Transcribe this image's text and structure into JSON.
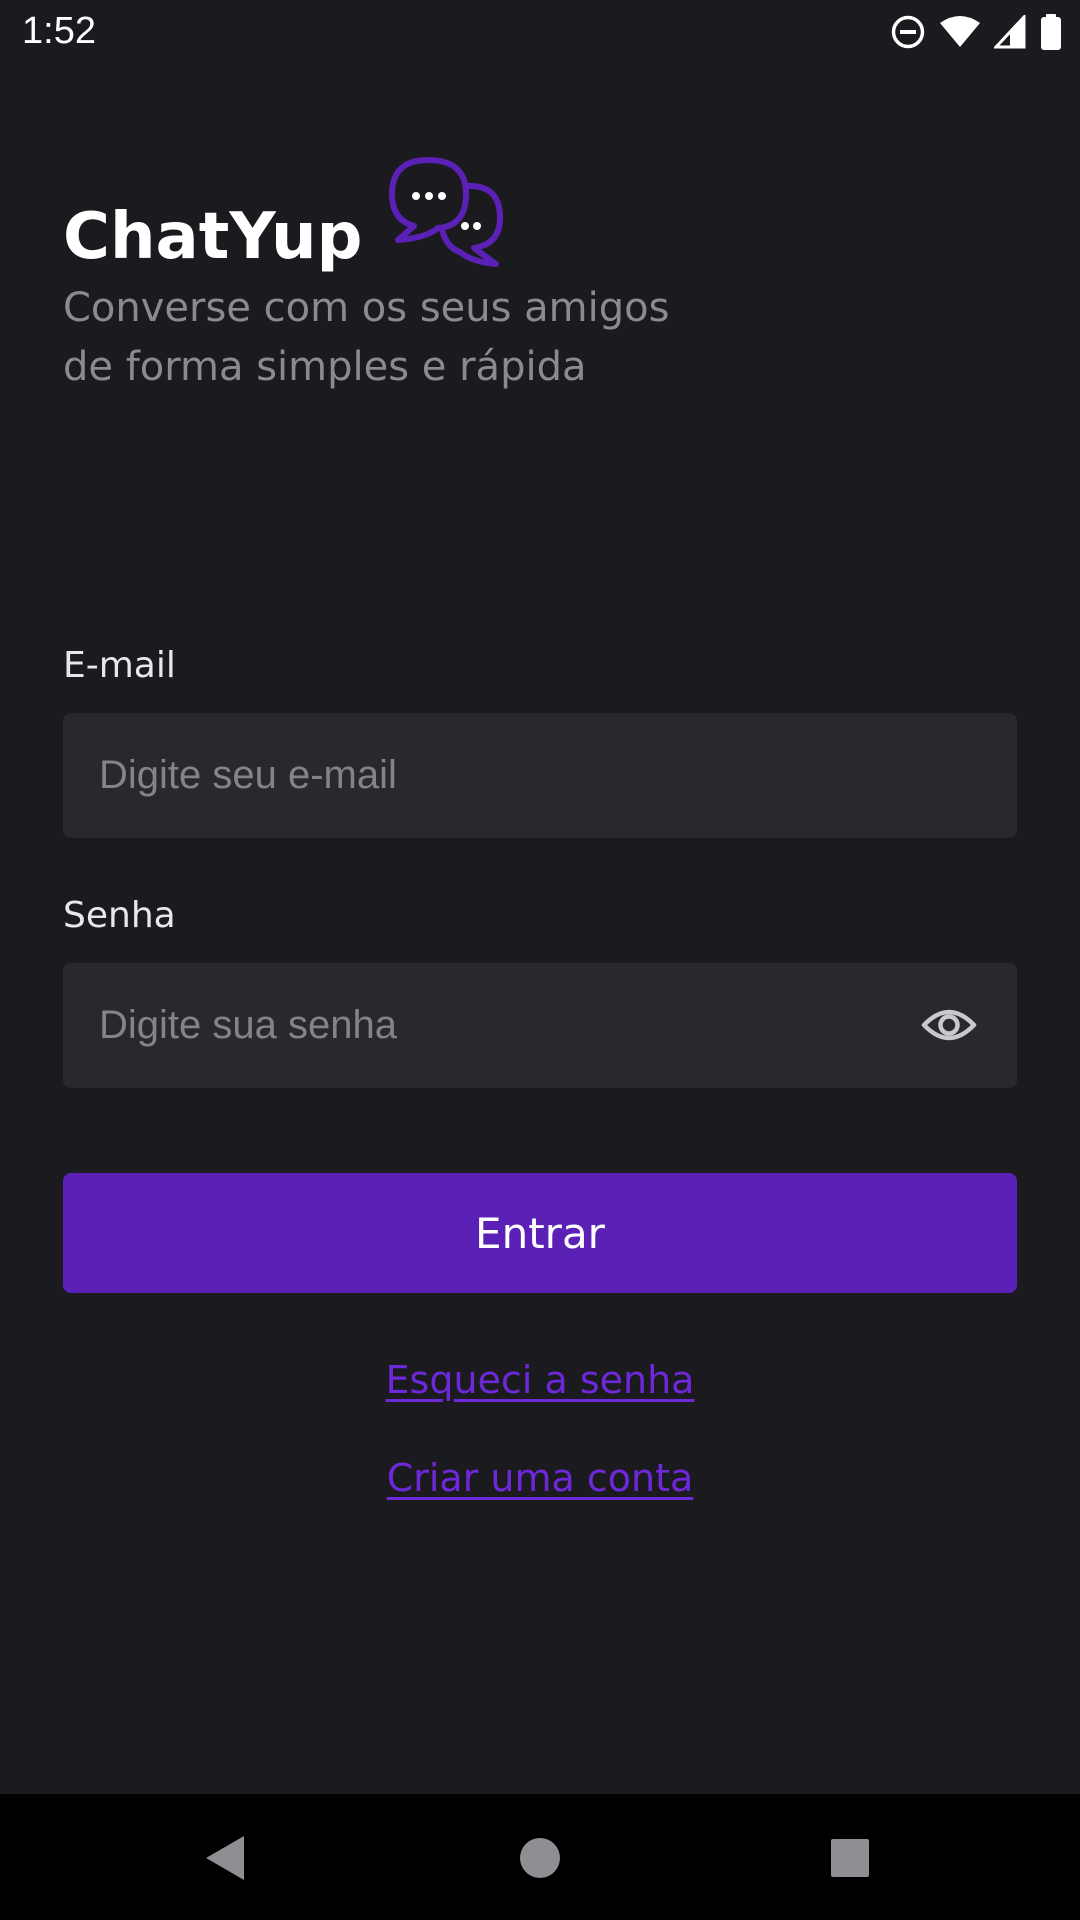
{
  "status_bar": {
    "time": "1:52",
    "icons": [
      "do-not-disturb-icon",
      "wifi-icon",
      "signal-icon",
      "battery-icon"
    ]
  },
  "header": {
    "app_name": "ChatYup",
    "logo_icon": "chat-bubbles-icon",
    "subtitle_line1": "Converse com os seus amigos",
    "subtitle_line2": "de forma simples e rápida"
  },
  "form": {
    "email": {
      "label": "E-mail",
      "placeholder": "Digite seu e-mail",
      "value": ""
    },
    "password": {
      "label": "Senha",
      "placeholder": "Digite sua senha",
      "value": "",
      "toggle_icon": "eye-icon"
    },
    "submit_label": "Entrar",
    "forgot_password_label": "Esqueci a senha",
    "create_account_label": "Criar uma conta"
  },
  "nav_bar": {
    "buttons": [
      "back-icon",
      "home-icon",
      "recents-icon"
    ]
  },
  "colors": {
    "background": "#1b1a1f",
    "input_background": "#29292d",
    "accent": "#5b21b6",
    "link": "#6d28d9",
    "subtitle": "#8b8a91"
  }
}
